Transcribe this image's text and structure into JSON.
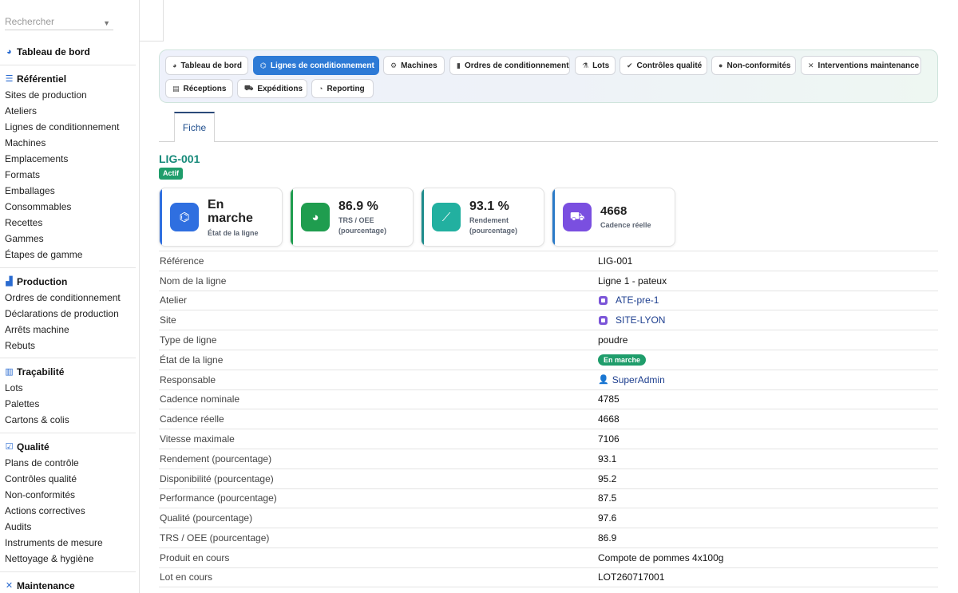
{
  "sidebar": {
    "search_placeholder": "Rechercher",
    "dashboard": "Tableau de bord",
    "sections": [
      {
        "title": "Référentiel",
        "items": [
          "Sites de production",
          "Ateliers",
          "Lignes de conditionnement",
          "Machines",
          "Emplacements",
          "Formats",
          "Emballages",
          "Consommables",
          "Recettes",
          "Gammes",
          "Étapes de gamme"
        ]
      },
      {
        "title": "Production",
        "items": [
          "Ordres de conditionnement",
          "Déclarations de production",
          "Arrêts machine",
          "Rebuts"
        ]
      },
      {
        "title": "Traçabilité",
        "items": [
          "Lots",
          "Palettes",
          "Cartons & colis"
        ]
      },
      {
        "title": "Qualité",
        "items": [
          "Plans de contrôle",
          "Contrôles qualité",
          "Non-conformités",
          "Actions correctives",
          "Audits",
          "Instruments de mesure",
          "Nettoyage & hygiène"
        ]
      },
      {
        "title": "Maintenance",
        "items": []
      }
    ]
  },
  "nav": {
    "buttons": [
      "Tableau de bord",
      "Lignes de conditionnement",
      "Machines",
      "Ordres de conditionnement",
      "Lots",
      "Contrôles qualité",
      "Non-conformités",
      "Interventions maintenance",
      "Réceptions",
      "Expéditions",
      "Reporting"
    ],
    "active_index": 1
  },
  "tabs": {
    "fiche": "Fiche"
  },
  "record": {
    "title": "LIG-001",
    "status_badge": "Actif"
  },
  "kpis": [
    {
      "value_line1": "En",
      "value_line2": "marche",
      "label": "État de la ligne",
      "color": "#2f6fe0",
      "bar": "#2f6fe0"
    },
    {
      "value": "86.9 %",
      "label_line1": "TRS / OEE",
      "label_line2": "(pourcentage)",
      "color": "#1f9d4f",
      "bar": "#1f9d4f"
    },
    {
      "value": "93.1 %",
      "label_line1": "Rendement",
      "label_line2": "(pourcentage)",
      "color": "#22b0a0",
      "bar": "#1e8c8c"
    },
    {
      "value": "4668",
      "label_line1": "Cadence réelle",
      "color": "#7a4fe0",
      "bar": "#2a7ac8"
    }
  ],
  "details": [
    {
      "key": "Référence",
      "value": "LIG-001"
    },
    {
      "key": "Nom de la ligne",
      "value": "Ligne 1 - pateux"
    },
    {
      "key": "Atelier",
      "value": "ATE-pre-1",
      "type": "link"
    },
    {
      "key": "Site",
      "value": "SITE-LYON",
      "type": "link"
    },
    {
      "key": "Type de ligne",
      "value": "poudre"
    },
    {
      "key": "État de la ligne",
      "value": "En marche",
      "type": "pill"
    },
    {
      "key": "Responsable",
      "value": "SuperAdmin",
      "type": "user"
    },
    {
      "key": "Cadence nominale",
      "value": "4785"
    },
    {
      "key": "Cadence réelle",
      "value": "4668"
    },
    {
      "key": "Vitesse maximale",
      "value": "7106"
    },
    {
      "key": "Rendement (pourcentage)",
      "value": "93.1"
    },
    {
      "key": "Disponibilité (pourcentage)",
      "value": "95.2"
    },
    {
      "key": "Performance (pourcentage)",
      "value": "87.5"
    },
    {
      "key": "Qualité (pourcentage)",
      "value": "97.6"
    },
    {
      "key": "TRS / OEE (pourcentage)",
      "value": "86.9"
    },
    {
      "key": "Produit en cours",
      "value": "Compote de pommes 4x100g"
    },
    {
      "key": "Lot en cours",
      "value": "LOT260717001"
    }
  ]
}
